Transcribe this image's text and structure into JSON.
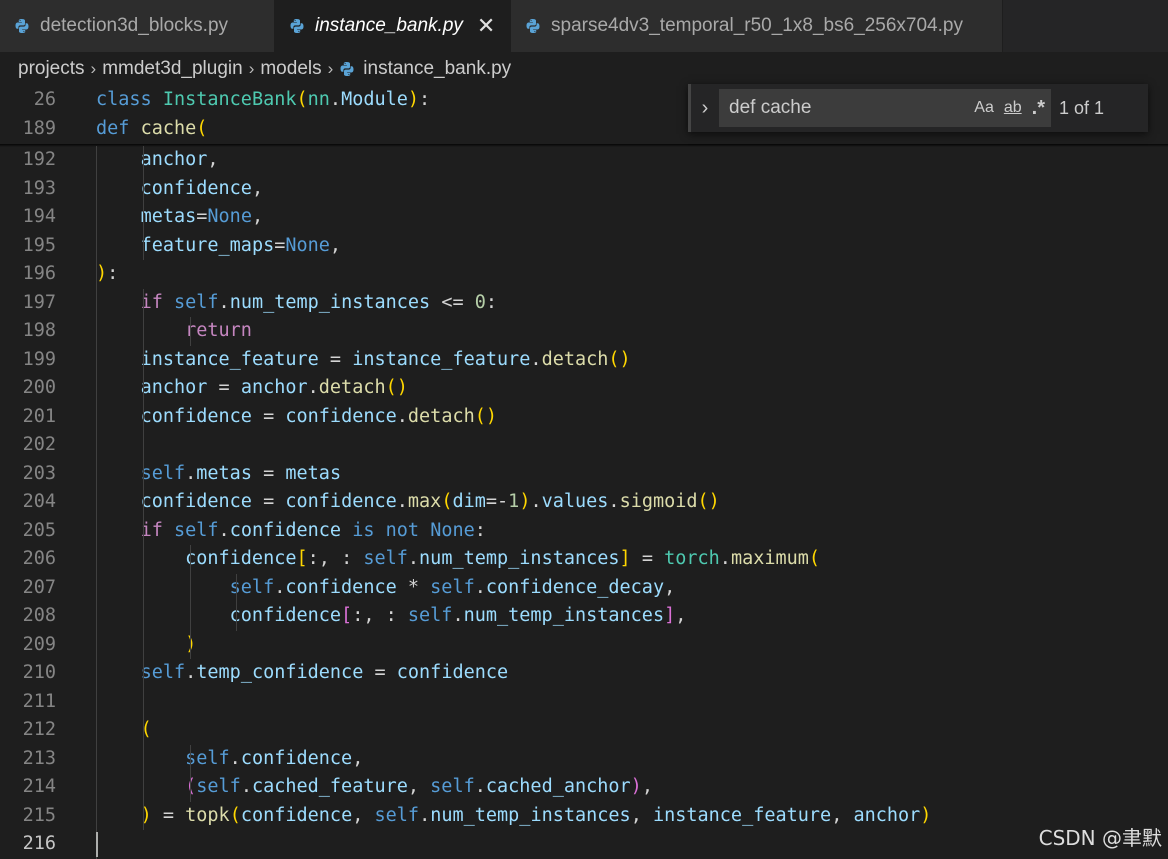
{
  "tabs": [
    {
      "label": "detection3d_blocks.py",
      "icon": "python-icon",
      "active": false
    },
    {
      "label": "instance_bank.py",
      "icon": "python-icon",
      "active": true,
      "close": "✕"
    },
    {
      "label": "sparse4dv3_temporal_r50_1x8_bs6_256x704.py",
      "icon": "python-icon",
      "active": false
    }
  ],
  "breadcrumb": {
    "items": [
      "projects",
      "mmdet3d_plugin",
      "models",
      "instance_bank.py"
    ],
    "separator": "›"
  },
  "find": {
    "toggle_glyph": "›",
    "value": "def cache",
    "match_case": "Aa",
    "whole_word": "ab",
    "regex": ".*",
    "count": "1 of 1"
  },
  "editor": {
    "sticky_lines": [
      {
        "num": "26",
        "text": "class InstanceBank(nn.Module):"
      },
      {
        "num": "189",
        "text": "    def cache("
      }
    ],
    "lines": [
      {
        "num": "192",
        "text": "        anchor,"
      },
      {
        "num": "193",
        "text": "        confidence,"
      },
      {
        "num": "194",
        "text": "        metas=None,"
      },
      {
        "num": "195",
        "text": "        feature_maps=None,"
      },
      {
        "num": "196",
        "text": "    ):"
      },
      {
        "num": "197",
        "text": "        if self.num_temp_instances <= 0:"
      },
      {
        "num": "198",
        "text": "            return"
      },
      {
        "num": "199",
        "text": "        instance_feature = instance_feature.detach()"
      },
      {
        "num": "200",
        "text": "        anchor = anchor.detach()"
      },
      {
        "num": "201",
        "text": "        confidence = confidence.detach()"
      },
      {
        "num": "202",
        "text": ""
      },
      {
        "num": "203",
        "text": "        self.metas = metas"
      },
      {
        "num": "204",
        "text": "        confidence = confidence.max(dim=-1).values.sigmoid()"
      },
      {
        "num": "205",
        "text": "        if self.confidence is not None:"
      },
      {
        "num": "206",
        "text": "            confidence[:, : self.num_temp_instances] = torch.maximum("
      },
      {
        "num": "207",
        "text": "                self.confidence * self.confidence_decay,"
      },
      {
        "num": "208",
        "text": "                confidence[:, : self.num_temp_instances],"
      },
      {
        "num": "209",
        "text": "            )"
      },
      {
        "num": "210",
        "text": "        self.temp_confidence = confidence"
      },
      {
        "num": "211",
        "text": ""
      },
      {
        "num": "212",
        "text": "        ("
      },
      {
        "num": "213",
        "text": "            self.confidence,"
      },
      {
        "num": "214",
        "text": "            (self.cached_feature, self.cached_anchor),"
      },
      {
        "num": "215",
        "text": "        ) = topk(confidence, self.num_temp_instances, instance_feature, anchor)"
      },
      {
        "num": "216",
        "text": ""
      }
    ],
    "current_line": "216"
  },
  "watermark": "CSDN @聿默"
}
